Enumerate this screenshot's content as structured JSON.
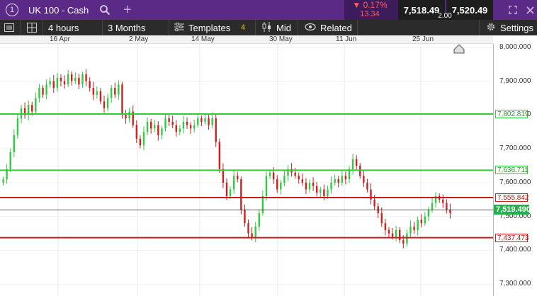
{
  "header": {
    "instrument_number": "1",
    "instrument_name": "UK 100 - Cash",
    "change_pct": "▼ 0.17%",
    "change_pts": "13.34",
    "sell_price": "7,518.49",
    "buy_price": "7,520.49",
    "spread": "2.00"
  },
  "toolbar": {
    "interval": "4 hours",
    "range": "3 Months",
    "templates": "Templates",
    "templates_count": "4",
    "price_type": "Mid",
    "related": "Related",
    "settings": "Settings"
  },
  "icons": {
    "search": "search-icon",
    "add": "plus-icon",
    "expand": "expand-icon",
    "close": "close-icon",
    "menu": "menu-icon",
    "layout": "layout-icon",
    "templates": "sliders-icon",
    "mid": "candles-icon",
    "related": "eye-icon",
    "settings": "gear-icon",
    "home": "house-icon"
  },
  "colors": {
    "header_bg": "#5b2a86",
    "toolbar_bg": "#2b2b2b",
    "candle_up": "#2ecc40",
    "candle_down": "#d11f1f",
    "support_line": "#33cc33",
    "resistance_line": "#cc1a1a",
    "current_price_bg": "#21b24b"
  },
  "chart_data": {
    "type": "candlestick",
    "x_labels": [
      "16 Apr",
      "2 May",
      "14 May",
      "30 May",
      "11 Jun",
      "25 Jun"
    ],
    "y_ticks": [
      "8,000.000",
      "7,900.000",
      "7,800.000",
      "7,700.000",
      "7,600.000",
      "7,500.000",
      "7,400.000",
      "7,300.000"
    ],
    "y_tick_values": [
      8000,
      7900,
      7800,
      7700,
      7600,
      7500,
      7400,
      7300
    ],
    "ylim": [
      7265,
      8010
    ],
    "levels": [
      {
        "value": 7802.819,
        "label": "7,802.819",
        "color": "green"
      },
      {
        "value": 7636.711,
        "label": "7,636.711",
        "color": "green"
      },
      {
        "value": 7555.842,
        "label": "7,555.842",
        "color": "red"
      },
      {
        "value": 7437.473,
        "label": "7,437.473",
        "color": "red"
      }
    ],
    "current_price": 7519.49,
    "current_price_label": "7,519.490",
    "closes": [
      7610,
      7640,
      7690,
      7740,
      7790,
      7820,
      7800,
      7830,
      7810,
      7850,
      7880,
      7860,
      7890,
      7900,
      7880,
      7910,
      7900,
      7890,
      7920,
      7900,
      7910,
      7890,
      7920,
      7900,
      7880,
      7860,
      7870,
      7840,
      7820,
      7850,
      7880,
      7860,
      7890,
      7800,
      7790,
      7810,
      7770,
      7730,
      7710,
      7750,
      7780,
      7760,
      7770,
      7740,
      7760,
      7790,
      7780,
      7770,
      7750,
      7760,
      7780,
      7770,
      7760,
      7770,
      7790,
      7780,
      7790,
      7770,
      7790,
      7720,
      7640,
      7600,
      7560,
      7580,
      7620,
      7610,
      7520,
      7480,
      7450,
      7440,
      7470,
      7510,
      7560,
      7620,
      7630,
      7610,
      7580,
      7600,
      7620,
      7640,
      7630,
      7620,
      7610,
      7600,
      7580,
      7600,
      7590,
      7570,
      7580,
      7560,
      7580,
      7600,
      7610,
      7600,
      7620,
      7610,
      7640,
      7670,
      7650,
      7620,
      7600,
      7580,
      7550,
      7530,
      7510,
      7480,
      7460,
      7450,
      7440,
      7460,
      7430,
      7420,
      7450,
      7470,
      7460,
      7490,
      7480,
      7500,
      7520,
      7540,
      7560,
      7550,
      7540,
      7520,
      7510
    ]
  }
}
